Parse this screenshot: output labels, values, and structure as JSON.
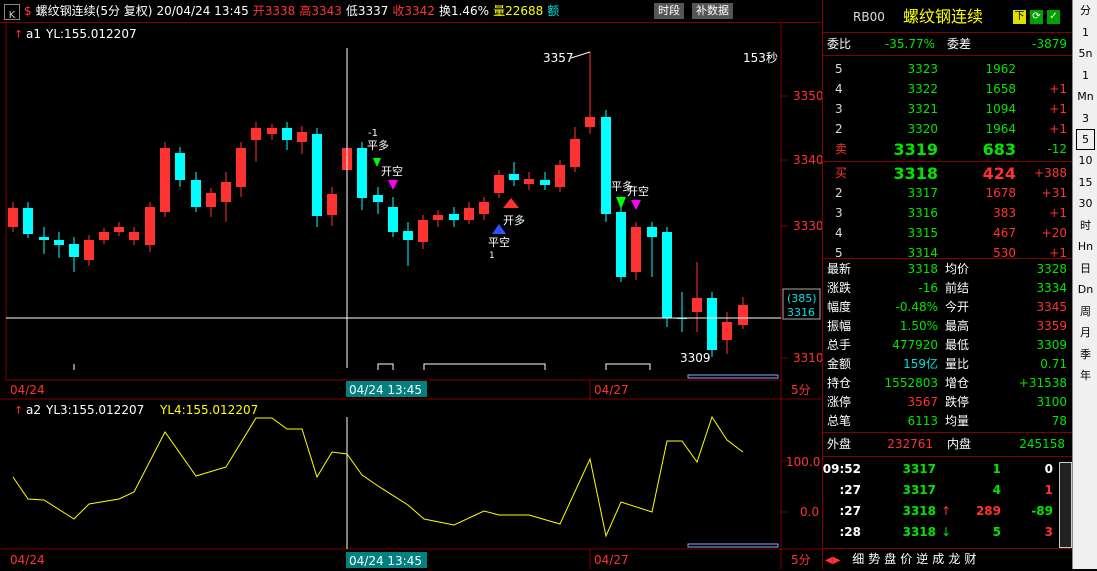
{
  "toolbar": {
    "k_label": "K",
    "dollar_label": "$",
    "symbol": "螺纹钢连续(5分 复权)",
    "date": "20/04/24 13:45",
    "open": "开3338",
    "high": "高3343",
    "low": "低3337",
    "close": "收3342",
    "turnover": "换1.46%",
    "volume": "量22688",
    "amount_label": "额",
    "btn_time": "时段",
    "btn_supplement": "补数据"
  },
  "chart": {
    "main_label": "a1",
    "main_indicator": "YL:155.012207",
    "sub_label": "a2",
    "sub_indicator1": "YL3:155.012207",
    "sub_indicator2": "YL4:155.012207",
    "countdown": "153秒",
    "price_axis": [
      "3350",
      "3340",
      "3330",
      "3310"
    ],
    "sub_axis": [
      "100.0",
      "0.0"
    ],
    "crosshair_price1": "(385)",
    "crosshair_price2": "3316",
    "marker_high": "3357",
    "marker_low": "3309",
    "x_labels": [
      "04/24",
      "04/27"
    ],
    "crosshair_time": "04/24 13:45",
    "period_tag": "5分",
    "sig1": "平多",
    "sig2": "开空",
    "sig3": "开多",
    "sig4": "平空",
    "sig_n1": "-1",
    "sig_p1": "1",
    "colors": {
      "up": "#ff3232",
      "down": "#00ffff",
      "axis": "#800000",
      "line": "#ffff00"
    }
  },
  "panel": {
    "code": "RB00",
    "name": "螺纹钢连续",
    "wb_label": "委比",
    "wb_value": "-35.77%",
    "wc_label": "委差",
    "wc_value": "-3879",
    "asks": [
      {
        "lvl": "5",
        "price": "3323",
        "vol": "1962",
        "chg": ""
      },
      {
        "lvl": "4",
        "price": "3322",
        "vol": "1658",
        "chg": "+1"
      },
      {
        "lvl": "3",
        "price": "3321",
        "vol": "1094",
        "chg": "+1"
      },
      {
        "lvl": "2",
        "price": "3320",
        "vol": "1964",
        "chg": "+1"
      },
      {
        "lvl": "卖",
        "price": "3319",
        "vol": "683",
        "chg": "-12"
      }
    ],
    "bids": [
      {
        "lvl": "买",
        "price": "3318",
        "vol": "424",
        "chg": "+388"
      },
      {
        "lvl": "2",
        "price": "3317",
        "vol": "1678",
        "chg": "+31"
      },
      {
        "lvl": "3",
        "price": "3316",
        "vol": "383",
        "chg": "+1"
      },
      {
        "lvl": "4",
        "price": "3315",
        "vol": "467",
        "chg": "+20"
      },
      {
        "lvl": "5",
        "price": "3314",
        "vol": "530",
        "chg": "+1"
      }
    ],
    "stats": [
      {
        "l1": "最新",
        "v1": "3318",
        "l2": "均价",
        "v2": "3328"
      },
      {
        "l1": "涨跌",
        "v1": "-16",
        "l2": "前结",
        "v2": "3334"
      },
      {
        "l1": "幅度",
        "v1": "-0.48%",
        "l2": "今开",
        "v2": "3345"
      },
      {
        "l1": "振幅",
        "v1": "1.50%",
        "l2": "最高",
        "v2": "3359"
      },
      {
        "l1": "总手",
        "v1": "477920",
        "l2": "最低",
        "v2": "3309"
      },
      {
        "l1": "金额",
        "v1": "159亿",
        "l2": "量比",
        "v2": "0.71"
      },
      {
        "l1": "持仓",
        "v1": "1552803",
        "l2": "增仓",
        "v2": "+31538"
      },
      {
        "l1": "涨停",
        "v1": "3567",
        "l2": "跌停",
        "v2": "3100"
      },
      {
        "l1": "总笔",
        "v1": "6113",
        "l2": "均量",
        "v2": "78"
      }
    ],
    "outer_label": "外盘",
    "outer_value": "232761",
    "inner_label": "内盘",
    "inner_value": "245158",
    "ticks": [
      {
        "time": "09:52",
        "price": "3317",
        "vol": "1",
        "oi": "0",
        "arrow": ""
      },
      {
        "time": ":27",
        "price": "3317",
        "vol": "4",
        "oi": "1",
        "arrow": ""
      },
      {
        "time": ":27",
        "price": "3318",
        "vol": "289",
        "oi": "-89",
        "arrow": "↑"
      },
      {
        "time": ":28",
        "price": "3318",
        "vol": "5",
        "oi": "3",
        "arrow": "↓"
      }
    ],
    "bottom_tabs": [
      "细",
      "势",
      "盘",
      "价",
      "逆",
      "成",
      "龙",
      "财"
    ]
  },
  "periods": [
    "分",
    "1",
    "5n",
    "1",
    "Mn",
    "3",
    "5",
    "10",
    "15",
    "30",
    "时",
    "Hn",
    "日",
    "Dn",
    "周",
    "月",
    "季",
    "年"
  ],
  "selected_period": 6
}
